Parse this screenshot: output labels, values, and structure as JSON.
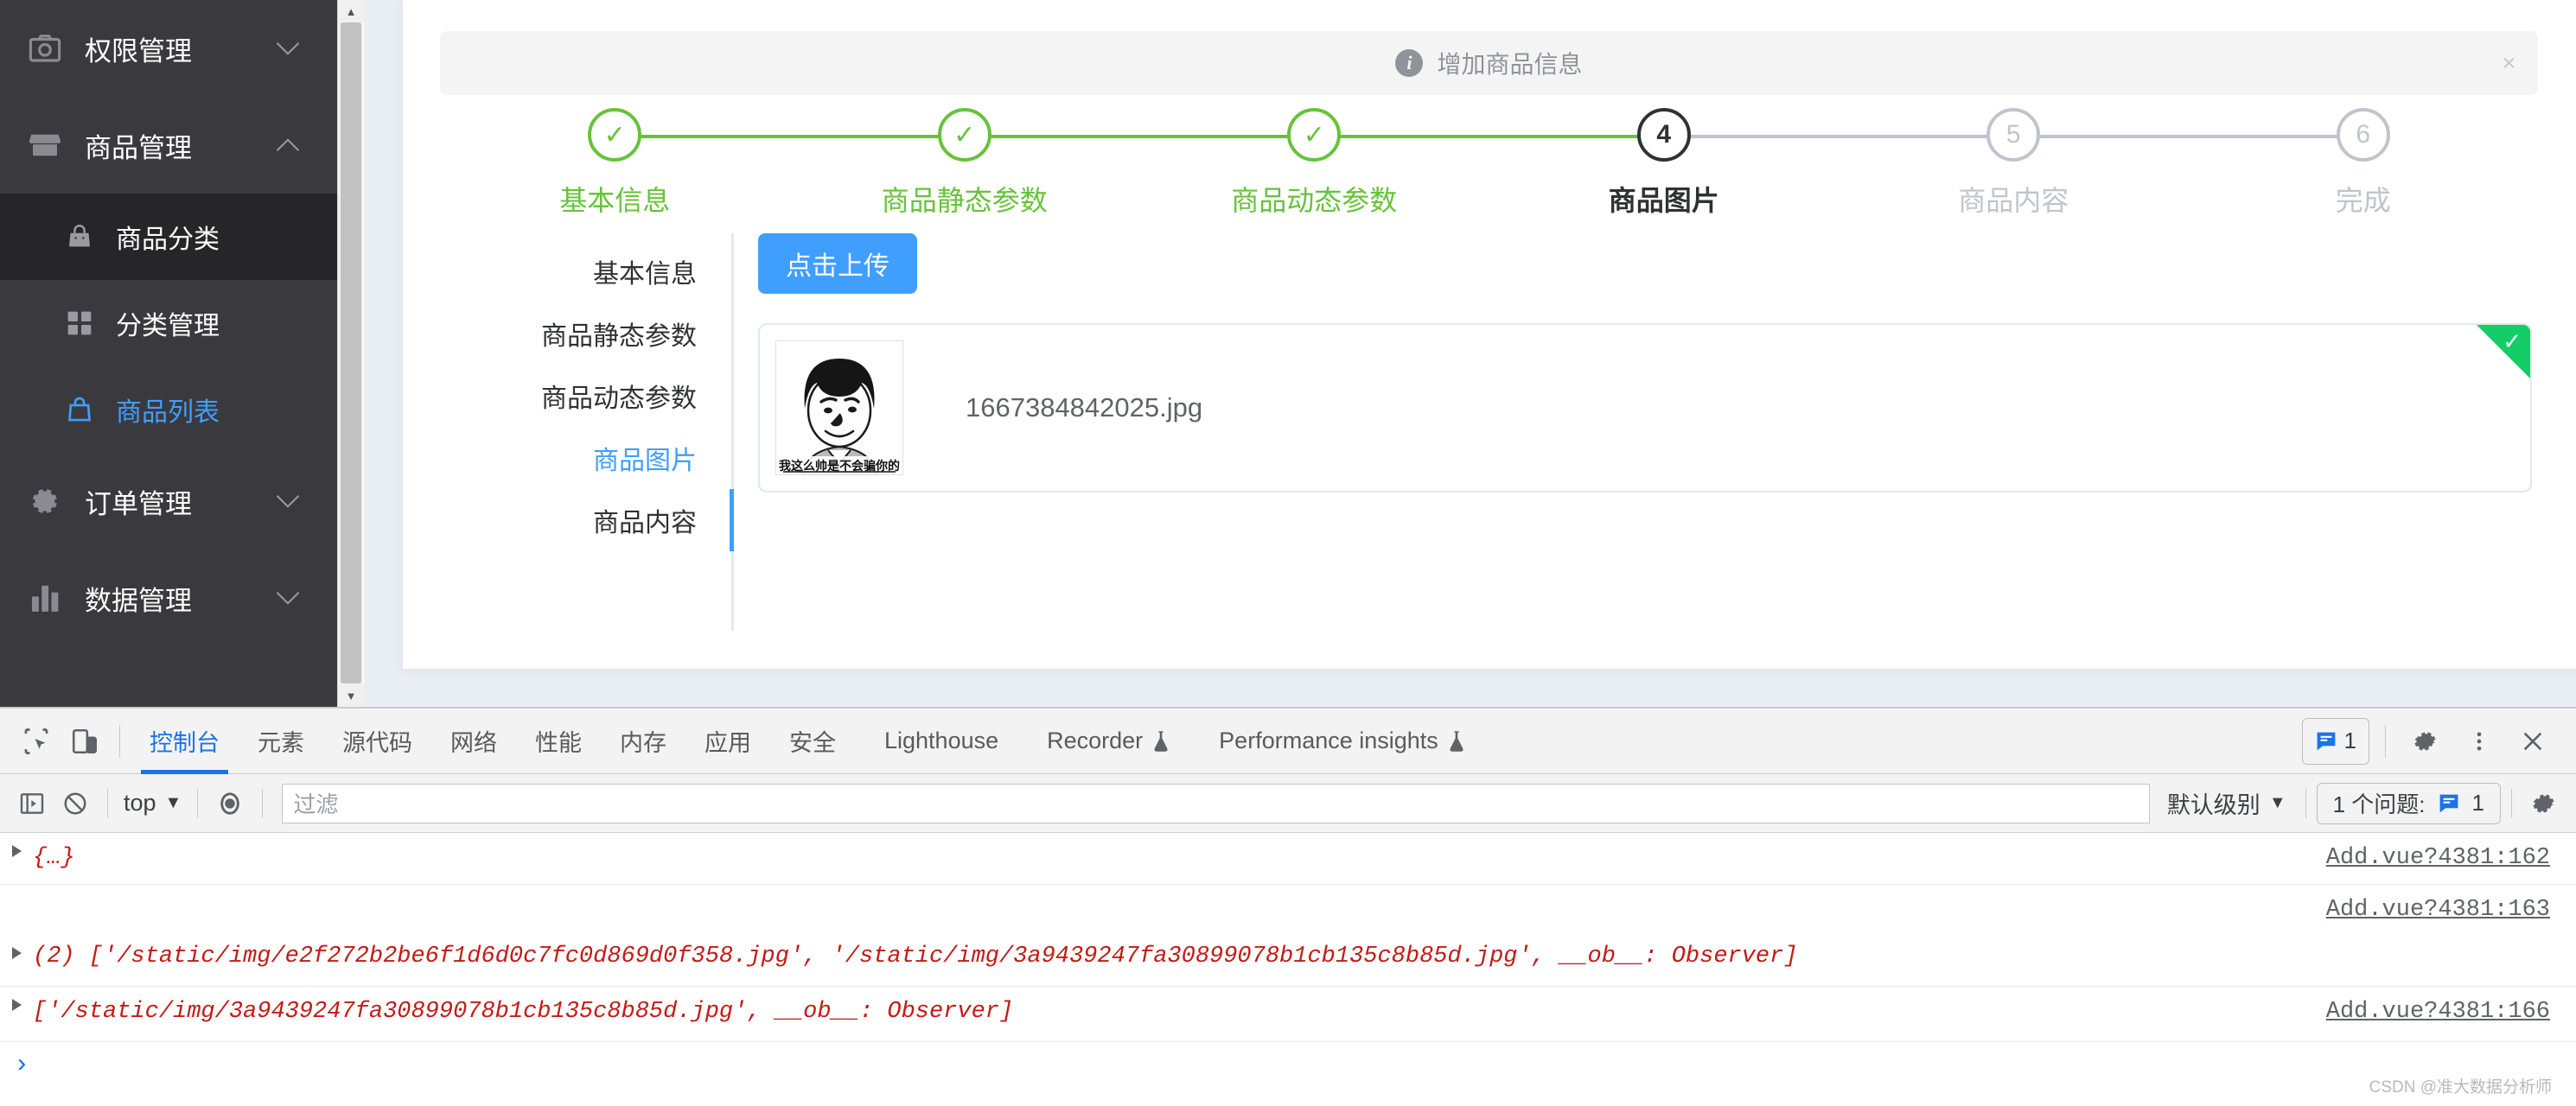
{
  "sidebar": {
    "groups": [
      {
        "label": "权限管理",
        "icon": "camera-icon",
        "caret": "chevron-down-icon",
        "expanded": false
      },
      {
        "label": "商品管理",
        "icon": "shop-icon",
        "caret": "chevron-up-icon",
        "expanded": true
      }
    ],
    "sub_items": [
      {
        "label": "商品分类",
        "icon": "handbag-icon",
        "state": "active"
      },
      {
        "label": "分类管理",
        "icon": "grid-icon",
        "state": "normal"
      },
      {
        "label": "商品列表",
        "icon": "bag-outline-icon",
        "state": "highlight"
      }
    ],
    "groups_tail": [
      {
        "label": "订单管理",
        "icon": "gear-icon",
        "caret": "chevron-down-icon"
      },
      {
        "label": "数据管理",
        "icon": "bar-chart-icon",
        "caret": "chevron-down-icon"
      }
    ]
  },
  "alert": {
    "text": "增加商品信息",
    "icon": "info-icon",
    "close": "×"
  },
  "steps": [
    {
      "num": "1",
      "title": "基本信息",
      "state": "done",
      "mark": "✓"
    },
    {
      "num": "2",
      "title": "商品静态参数",
      "state": "done",
      "mark": "✓"
    },
    {
      "num": "3",
      "title": "商品动态参数",
      "state": "done",
      "mark": "✓"
    },
    {
      "num": "4",
      "title": "商品图片",
      "state": "current",
      "mark": "4"
    },
    {
      "num": "5",
      "title": "商品内容",
      "state": "pending",
      "mark": "5"
    },
    {
      "num": "6",
      "title": "完成",
      "state": "pending",
      "mark": "6"
    }
  ],
  "vtabs": [
    {
      "label": "基本信息",
      "active": false
    },
    {
      "label": "商品静态参数",
      "active": false
    },
    {
      "label": "商品动态参数",
      "active": false
    },
    {
      "label": "商品图片",
      "active": true
    },
    {
      "label": "商品内容",
      "active": false
    }
  ],
  "upload": {
    "button_label": "点击上传",
    "file_name": "1667384842025.jpg",
    "thumb_caption": "我这么帅是不会骗你的",
    "success_mark": "✓"
  },
  "devtools": {
    "tabs": [
      {
        "label": "控制台",
        "active": true,
        "flask": false
      },
      {
        "label": "元素",
        "active": false,
        "flask": false
      },
      {
        "label": "源代码",
        "active": false,
        "flask": false
      },
      {
        "label": "网络",
        "active": false,
        "flask": false
      },
      {
        "label": "性能",
        "active": false,
        "flask": false
      },
      {
        "label": "内存",
        "active": false,
        "flask": false
      },
      {
        "label": "应用",
        "active": false,
        "flask": false
      },
      {
        "label": "安全",
        "active": false,
        "flask": false
      },
      {
        "label": "Lighthouse",
        "active": false,
        "flask": false
      },
      {
        "label": "Recorder",
        "active": false,
        "flask": true
      },
      {
        "label": "Performance insights",
        "active": false,
        "flask": true
      }
    ],
    "issue_chip_count": "1",
    "toolbar_icons": {
      "inspect": "inspect-icon",
      "device": "device-toolbar-icon",
      "settings": "gear-icon",
      "more": "more-vertical-icon",
      "close": "close-icon"
    },
    "filterbar": {
      "sidebar_toggle": "console-sidebar-icon",
      "clear": "clear-console-icon",
      "context": "top",
      "context_caret": "▼",
      "eye": "eye-icon",
      "filter_placeholder": "过滤",
      "filter_value": "",
      "level": "默认级别",
      "level_caret": "▼",
      "issues_label": "1 个问题:",
      "issues_count": "1",
      "settings": "gear-icon"
    },
    "console_rows": [
      {
        "type": "object",
        "text": "{…}",
        "source": "Add.vue?4381:162"
      },
      {
        "type": "array",
        "count": "(2) ",
        "text": "['/static/img/e2f272b2be6f1d6d0c7fc0d869d0f358.jpg', '/static/img/3a9439247fa30899078b1cb135c8b85d.jpg', __ob__: Observer]",
        "source": "Add.vue?4381:163"
      },
      {
        "type": "array",
        "count": "",
        "text": "['/static/img/3a9439247fa30899078b1cb135c8b85d.jpg', __ob__: Observer]",
        "source": "Add.vue?4381:166"
      }
    ],
    "prompt": "›",
    "watermark": "CSDN @准大数据分析师"
  },
  "colors": {
    "accent_blue": "#409eff",
    "success_green": "#67c23a",
    "sidebar_bg": "#3a3a3e",
    "devtools_blue": "#1a73e8",
    "error_red": "#c41a16"
  }
}
